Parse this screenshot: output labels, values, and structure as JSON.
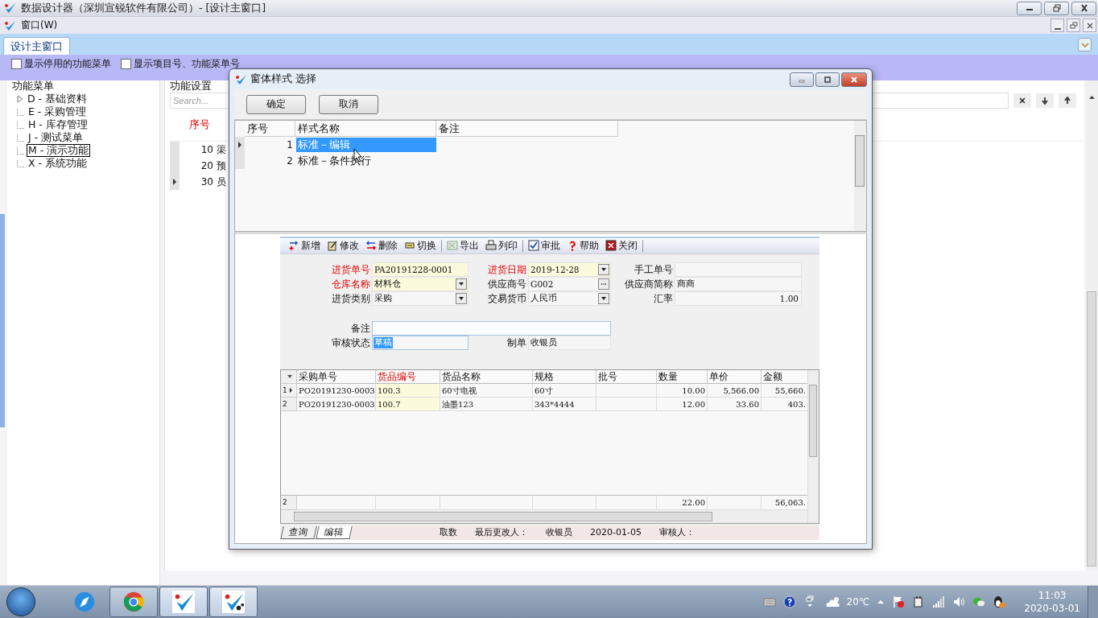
{
  "window": {
    "title": "数据设计器（深圳宣锐软件有限公司）- [设计主窗口]"
  },
  "menu": [
    {
      "label": "窗口(W)"
    }
  ],
  "tabs": [
    {
      "label": "设计主窗口",
      "selected": true
    }
  ],
  "options": [
    {
      "label": "显示停用的功能菜单",
      "checked": false
    },
    {
      "label": "显示项目号、功能菜单号",
      "checked": false
    }
  ],
  "function_menu": {
    "title": "功能菜单",
    "items": [
      {
        "label": "D - 基础资料",
        "kind": "group",
        "selected": false
      },
      {
        "label": "E - 采购管理",
        "kind": "leaf",
        "selected": false
      },
      {
        "label": "H - 库存管理",
        "kind": "leaf",
        "selected": false
      },
      {
        "label": "J - 测试菜单",
        "kind": "leaf",
        "selected": false
      },
      {
        "label": "M - 演示功能",
        "kind": "leaf",
        "selected": true
      },
      {
        "label": "X - 系统功能",
        "kind": "leaf",
        "selected": false
      }
    ]
  },
  "function_settings": {
    "title": "功能设置",
    "search": {
      "placeholder": "Search..."
    },
    "columns": [
      "序号"
    ],
    "rows": [
      {
        "no": "10",
        "name": "渠",
        "selected": false
      },
      {
        "no": "20",
        "name": "预",
        "selected": false
      },
      {
        "no": "30",
        "name": "员",
        "selected": true
      }
    ]
  },
  "dialog": {
    "title": "窗体样式 选择",
    "buttons": [
      "确定",
      "取消"
    ],
    "columns": [
      "序号",
      "样式名称",
      "备注"
    ],
    "rows": [
      {
        "no": "1",
        "name": "标准－编辑",
        "selected": true
      },
      {
        "no": "2",
        "name": "标准－条件执行",
        "selected": false
      }
    ],
    "preview": {
      "toolbar": [
        [
          {
            "label": "新增",
            "kind": "add"
          },
          {
            "label": "修改",
            "kind": "edit"
          },
          {
            "label": "删除",
            "kind": "delete"
          },
          {
            "label": "切换",
            "kind": "switch"
          }
        ],
        [
          {
            "label": "导出",
            "kind": "export"
          },
          {
            "label": "列印",
            "kind": "print"
          }
        ],
        [
          {
            "label": "审批",
            "kind": "approve"
          },
          {
            "label": "帮助",
            "kind": "help"
          },
          {
            "label": "关闭",
            "kind": "close"
          }
        ]
      ],
      "header_fields": [
        {
          "label": "进货单号",
          "value": "PA20191228-0001",
          "kind": "text",
          "required": true
        },
        {
          "label": "进货日期",
          "value": "2019-12-28",
          "kind": "dropdown",
          "required": true
        },
        {
          "label": "手工单号",
          "kind": "text",
          "required": false
        },
        {
          "label": "仓库名称",
          "value": "材料仓",
          "kind": "dropdown",
          "required": true
        },
        {
          "label": "供应商号",
          "value": "G002",
          "kind": "lookup",
          "required": false
        },
        {
          "label": "供应商简称",
          "value": "商商",
          "kind": "text",
          "required": false
        },
        {
          "label": "进货类别",
          "value": "采购",
          "kind": "dropdown",
          "required": false
        },
        {
          "label": "交易货币",
          "value": "人民币",
          "kind": "dropdown",
          "required": false
        },
        {
          "label": "汇率",
          "value": "1.00",
          "kind": "number",
          "required": false
        }
      ],
      "note_fields": [
        {
          "label": "备注",
          "kind": "memo",
          "required": false
        },
        {
          "label": "审核状态",
          "value": "草稿",
          "kind": "highlighted",
          "required": false
        },
        {
          "label": "制单",
          "value": "收银员",
          "kind": "text",
          "required": false
        }
      ],
      "grid": {
        "columns": [
          {
            "label": "采购单号",
            "required": false,
            "kind": "text"
          },
          {
            "label": "货品编号",
            "required": true,
            "kind": "text"
          },
          {
            "label": "货品名称",
            "required": false,
            "kind": "text"
          },
          {
            "label": "规格",
            "required": false,
            "kind": "text"
          },
          {
            "label": "批号",
            "required": false
          },
          {
            "label": "数量",
            "required": false,
            "kind": "number"
          },
          {
            "label": "单价",
            "required": false,
            "kind": "number"
          },
          {
            "label": "金额",
            "required": false,
            "kind": "number"
          }
        ],
        "rows": [
          {
            "no": "1",
            "selected": true,
            "cells": [
              "PO20191230-0003",
              "100.3",
              "60寸电视",
              "60寸",
              "",
              "10.00",
              "5,566.00",
              "55,660."
            ]
          },
          {
            "no": "2",
            "selected": false,
            "cells": [
              "PO20191230-0003",
              "100.7",
              "油墨123",
              "343*4444",
              "",
              "12.00",
              "33.60",
              "403."
            ]
          }
        ],
        "footer": {
          "no": "2",
          "cells": [
            "",
            "",
            "",
            "",
            "",
            "22.00",
            "",
            "56,063."
          ]
        }
      },
      "bottom_tabs": [
        {
          "label": "查询",
          "selected": false
        },
        {
          "label": "编辑",
          "selected": true
        }
      ],
      "status": [
        "取数",
        "最后更改人：",
        "收银员",
        "2020-01-05",
        "审核人："
      ]
    }
  },
  "taskbar": {
    "temperature": "20℃",
    "time": "11:03",
    "date": "2020-03-01"
  }
}
